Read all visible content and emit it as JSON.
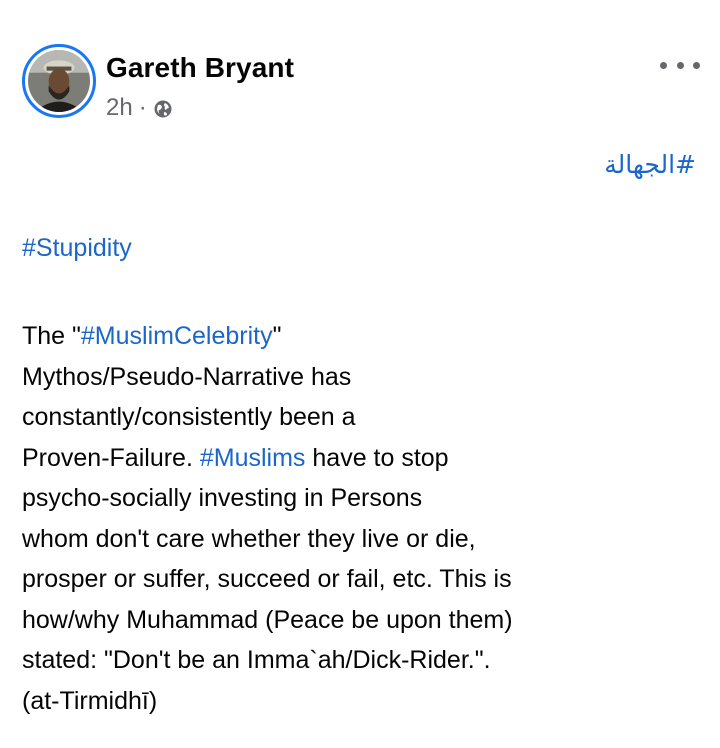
{
  "post": {
    "author": "Gareth Bryant",
    "time": "2h",
    "separator": "·",
    "privacy_icon": "globe-icon",
    "more_icon": "more-options-icon",
    "arabic_tag": "#الجهالة",
    "tag_stupidity": "#Stupidity",
    "body": {
      "l1_a": "The \"",
      "l1_tag": "#MuslimCelebrity",
      "l1_b": "\"",
      "l2": "Mythos/Pseudo-Narrative has",
      "l3": "constantly/consistently been a",
      "l4_a": "Proven-Failure. ",
      "l4_tag": "#Muslims",
      "l4_b": " have to stop",
      "l5": "psycho-socially investing in Persons",
      "l6": "whom don't care whether they live or die,",
      "l7": "prosper or suffer, succeed or fail, etc. This is",
      "l8": "how/why Muhammad (Peace be upon them)",
      "l9": "stated: \"Don't be an Imma`ah/Dick-Rider.\".",
      "l10": "(at-Tirmidhī)"
    }
  },
  "colors": {
    "link": "#1b66c9",
    "avatar_ring": "#1877f2",
    "meta": "#65676b"
  }
}
